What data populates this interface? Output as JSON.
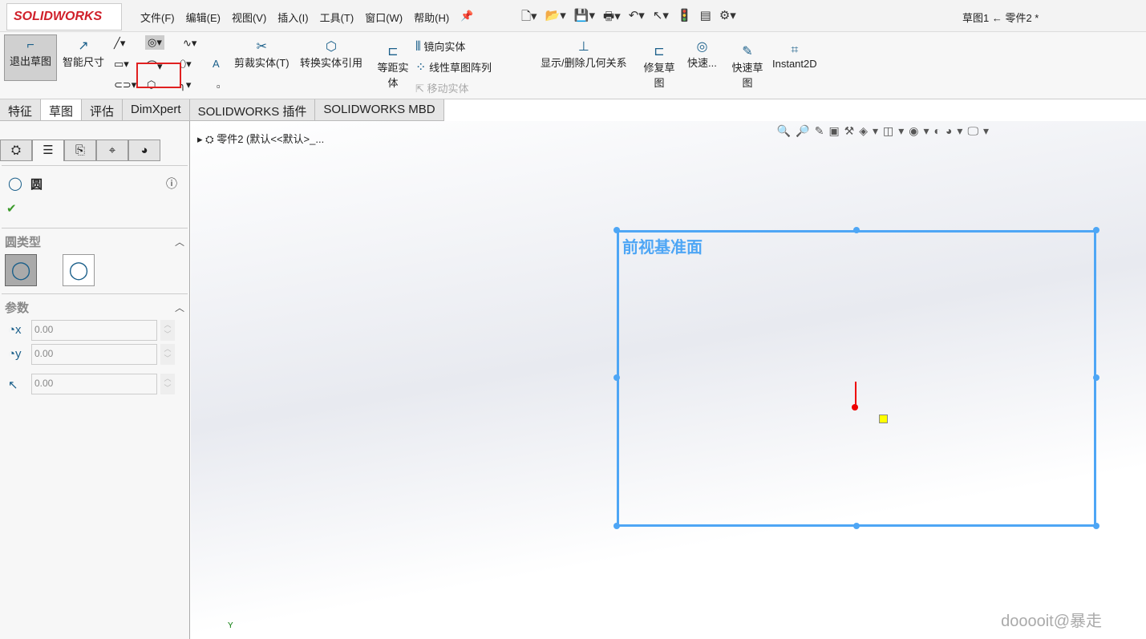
{
  "app": {
    "logo": "SOLIDWORKS",
    "window_title": "草图1 ← 零件2 *"
  },
  "menu": [
    "文件(F)",
    "编辑(E)",
    "视图(V)",
    "插入(I)",
    "工具(T)",
    "窗口(W)",
    "帮助(H)"
  ],
  "ribbon": {
    "exit_sketch": "退出草图",
    "smart_dim": "智能尺寸",
    "trim": "剪裁实体(T)",
    "convert": "转换实体引用",
    "offset": "等距实体",
    "mirror": "镜向实体",
    "linear_pattern": "线性草图阵列",
    "move": "移动实体",
    "display_relations": "显示/删除几何关系",
    "repair": "修复草图",
    "quick_snaps": "快速...",
    "rapid_sketch": "快速草图",
    "instant2d": "Instant2D"
  },
  "tabs": [
    "特征",
    "草图",
    "评估",
    "DimXpert",
    "SOLIDWORKS 插件",
    "SOLIDWORKS MBD"
  ],
  "panel": {
    "title": "圆",
    "circle_type": "圆类型",
    "params": "参数",
    "x": "0.00",
    "y": "0.00",
    "r": "0.00"
  },
  "tree": {
    "root": "零件2  (默认<<默认>_..."
  },
  "viewport": {
    "plane_label": "前视基准面",
    "axis_y": "Y",
    "watermark": "dooooit@暴走",
    "plane_color": "#4ea6f5"
  }
}
